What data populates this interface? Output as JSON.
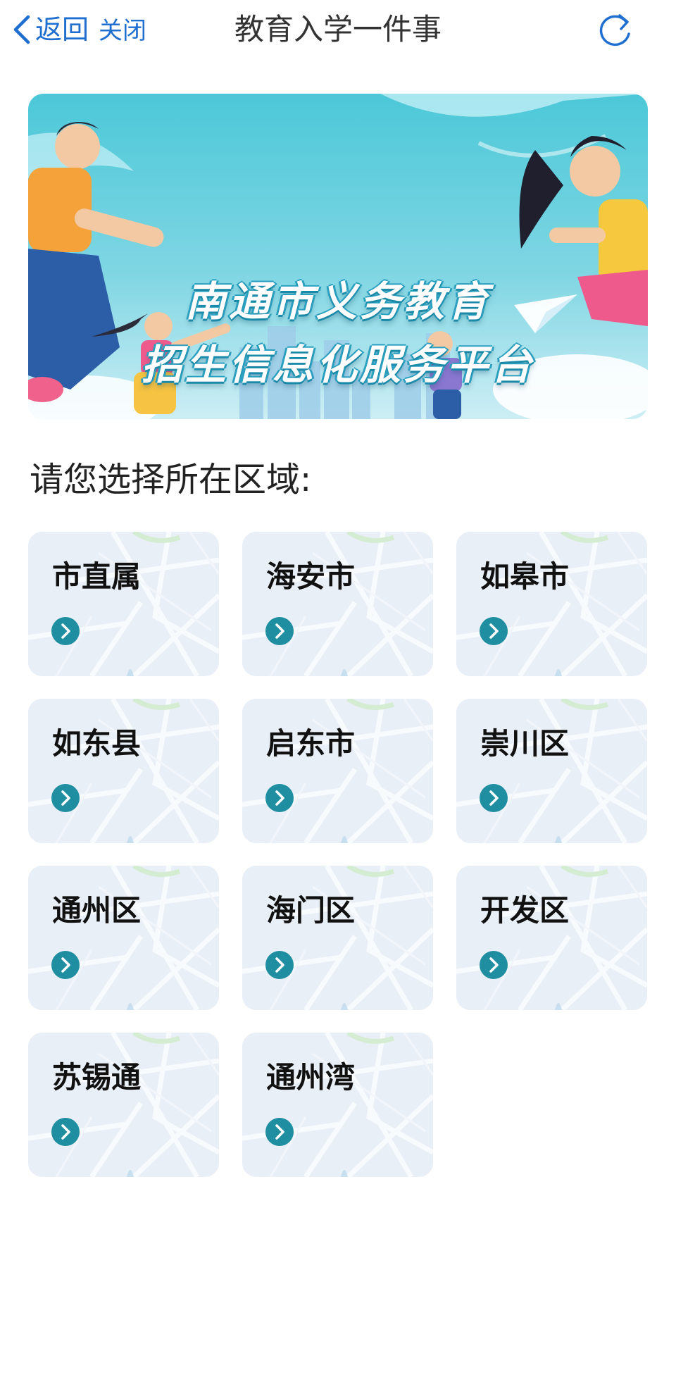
{
  "nav": {
    "back_label": "返回",
    "close_label": "关闭",
    "title": "教育入学一件事",
    "refresh_icon": "refresh-icon"
  },
  "banner": {
    "line1": "南通市义务教育",
    "line2": "招生信息化服务平台"
  },
  "prompt": "请您选择所在区域:",
  "regions": [
    {
      "label": "市直属"
    },
    {
      "label": "海安市"
    },
    {
      "label": "如皋市"
    },
    {
      "label": "如东县"
    },
    {
      "label": "启东市"
    },
    {
      "label": "崇川区"
    },
    {
      "label": "通州区"
    },
    {
      "label": "海门区"
    },
    {
      "label": "开发区"
    },
    {
      "label": "苏锡通"
    },
    {
      "label": "通州湾"
    }
  ],
  "colors": {
    "link_blue": "#1f6fd0",
    "arrow_teal": "#1e8ea0",
    "card_bg": "#eaf0f6",
    "banner_teal": "#47c3d6"
  }
}
